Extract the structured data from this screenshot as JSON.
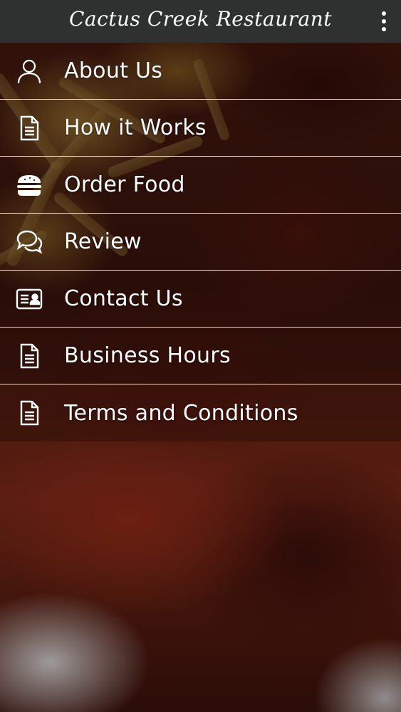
{
  "app_bar": {
    "title": "Cactus Creek Restaurant",
    "overflow_icon": "more-vert-icon"
  },
  "menu": {
    "items": [
      {
        "label": "About Us",
        "icon": "user-icon"
      },
      {
        "label": "How it Works",
        "icon": "document-icon"
      },
      {
        "label": "Order Food",
        "icon": "burger-icon"
      },
      {
        "label": "Review",
        "icon": "chat-bubbles-icon"
      },
      {
        "label": "Contact Us",
        "icon": "contact-card-icon"
      },
      {
        "label": "Business Hours",
        "icon": "document-icon"
      },
      {
        "label": "Terms and Conditions",
        "icon": "document-icon"
      }
    ]
  },
  "colors": {
    "app_bar_background": "#2f3030",
    "menu_text": "#ffffff",
    "divider": "#ffffff"
  }
}
